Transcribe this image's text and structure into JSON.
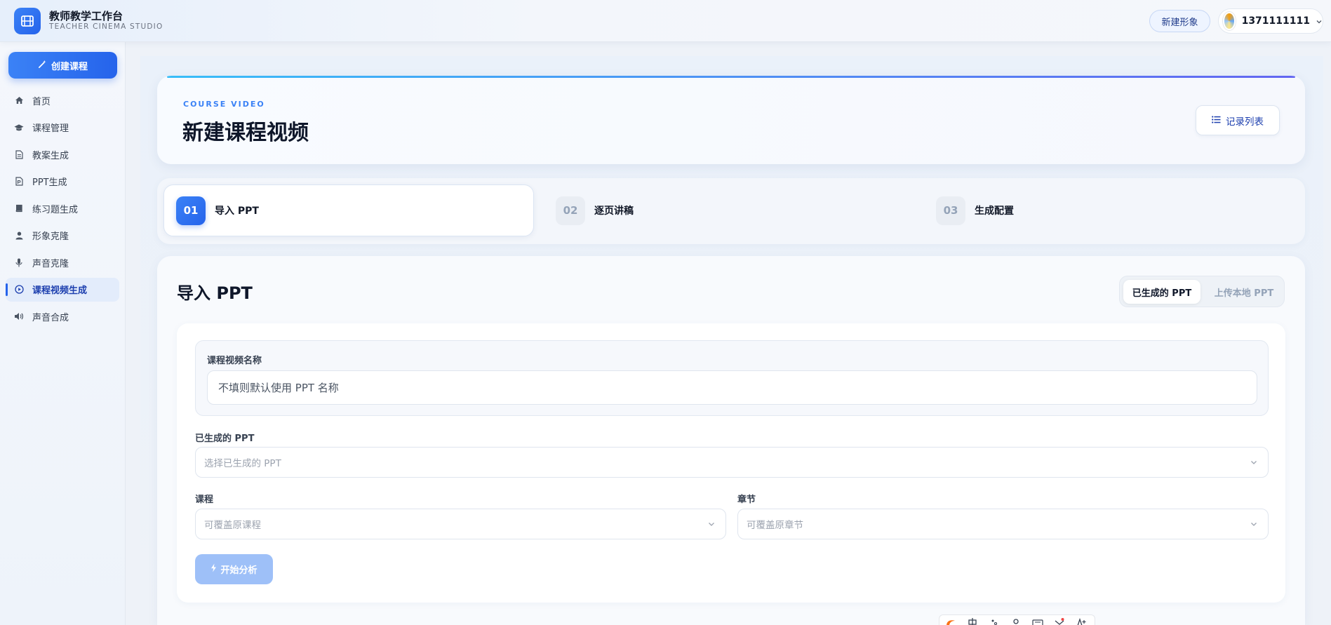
{
  "app": {
    "title": "教师教学工作台",
    "subtitle": "TEACHER CINEMA STUDIO"
  },
  "topbar": {
    "new_avatar_label": "新建形象",
    "user_name": "1371111111"
  },
  "sidebar": {
    "create_label": "创建课程",
    "items": [
      {
        "label": "首页",
        "icon": "home-icon"
      },
      {
        "label": "课程管理",
        "icon": "graduation-cap-icon"
      },
      {
        "label": "教案生成",
        "icon": "document-icon"
      },
      {
        "label": "PPT生成",
        "icon": "presentation-file-icon"
      },
      {
        "label": "练习题生成",
        "icon": "book-icon"
      },
      {
        "label": "形象克隆",
        "icon": "user-icon"
      },
      {
        "label": "声音克隆",
        "icon": "microphone-icon"
      },
      {
        "label": "课程视频生成",
        "icon": "play-circle-icon",
        "active": true
      },
      {
        "label": "声音合成",
        "icon": "speaker-icon"
      }
    ]
  },
  "header": {
    "eyebrow": "COURSE VIDEO",
    "title": "新建课程视频",
    "records_label": "记录列表"
  },
  "steps": [
    {
      "num": "01",
      "label": "导入 PPT",
      "active": true
    },
    {
      "num": "02",
      "label": "逐页讲稿",
      "active": false
    },
    {
      "num": "03",
      "label": "生成配置",
      "active": false
    }
  ],
  "import": {
    "title": "导入 PPT",
    "tabs": {
      "generated": "已生成的 PPT",
      "upload": "上传本地 PPT"
    },
    "name_label": "课程视频名称",
    "name_placeholder": "不填则默认使用 PPT 名称",
    "ppt_label": "已生成的 PPT",
    "ppt_placeholder": "选择已生成的 PPT",
    "course_label": "课程",
    "course_placeholder": "可覆盖原课程",
    "chapter_label": "章节",
    "chapter_placeholder": "可覆盖原章节",
    "start_label": "开始分析"
  },
  "colors": {
    "accent": "#2563eb",
    "accent_light": "#9ec0f8",
    "gradient_start": "#38bdf8",
    "gradient_end": "#6366f1"
  }
}
